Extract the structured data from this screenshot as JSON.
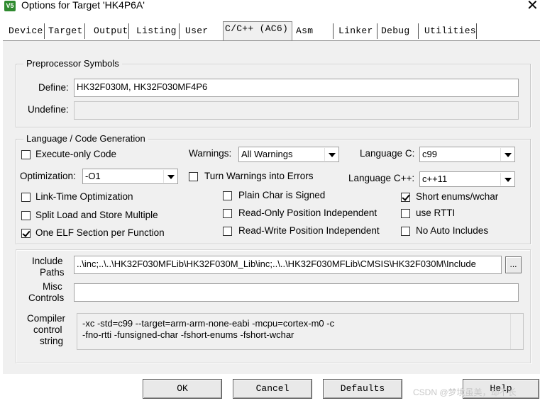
{
  "window": {
    "title": "Options for Target 'HK4P6A'",
    "app_icon_text": "V5"
  },
  "tabs": [
    {
      "label": "Device"
    },
    {
      "label": "Target"
    },
    {
      "label": "Output"
    },
    {
      "label": "Listing"
    },
    {
      "label": "User"
    },
    {
      "label": "C/C++ (AC6)",
      "active": true
    },
    {
      "label": "Asm"
    },
    {
      "label": "Linker"
    },
    {
      "label": "Debug"
    },
    {
      "label": "Utilities"
    }
  ],
  "preprocessor": {
    "title": "Preprocessor Symbols",
    "define_label": "Define:",
    "define_value": "HK32F030M, HK32F030MF4P6",
    "undefine_label": "Undefine:",
    "undefine_value": ""
  },
  "language": {
    "title": "Language / Code Generation",
    "execute_only": {
      "label": "Execute-only Code",
      "checked": false
    },
    "warnings_label": "Warnings:",
    "warnings_value": "All Warnings",
    "language_c_label": "Language C:",
    "language_c_value": "c99",
    "optimization_label": "Optimization:",
    "optimization_value": "-O1",
    "warnings_as_errors": {
      "label": "Turn Warnings into Errors",
      "checked": false
    },
    "language_cpp_label": "Language C++:",
    "language_cpp_value": "c++11",
    "lto": {
      "label": "Link-Time Optimization",
      "checked": false
    },
    "plain_char_signed": {
      "label": "Plain Char is Signed",
      "checked": false
    },
    "short_enums": {
      "label": "Short enums/wchar",
      "checked": true
    },
    "split_load": {
      "label": "Split Load and Store Multiple",
      "checked": false
    },
    "ro_pi": {
      "label": "Read-Only Position Independent",
      "checked": false
    },
    "use_rtti": {
      "label": "use RTTI",
      "checked": false
    },
    "one_elf": {
      "label": "One ELF Section per Function",
      "checked": true
    },
    "rw_pi": {
      "label": "Read-Write Position Independent",
      "checked": false
    },
    "no_auto_includes": {
      "label": "No Auto Includes",
      "checked": false
    }
  },
  "include": {
    "label_line1": "Include",
    "label_line2": "Paths",
    "value": "..\\inc;..\\..\\HK32F030MFLib\\HK32F030M_Lib\\inc;..\\..\\HK32F030MFLib\\CMSIS\\HK32F030M\\Include",
    "browse_label": "..."
  },
  "misc": {
    "label_line1": "Misc",
    "label_line2": "Controls",
    "value": ""
  },
  "compiler": {
    "label_line1": "Compiler",
    "label_line2": "control",
    "label_line3": "string",
    "line1": "-xc -std=c99 --target=arm-arm-none-eabi -mcpu=cortex-m0 -c",
    "line2": "-fno-rtti -funsigned-char -fshort-enums -fshort-wchar"
  },
  "buttons": {
    "ok": "OK",
    "cancel": "Cancel",
    "defaults": "Defaults",
    "help": "Help"
  },
  "watermark": "CSDN @梦境虽美，却不长"
}
